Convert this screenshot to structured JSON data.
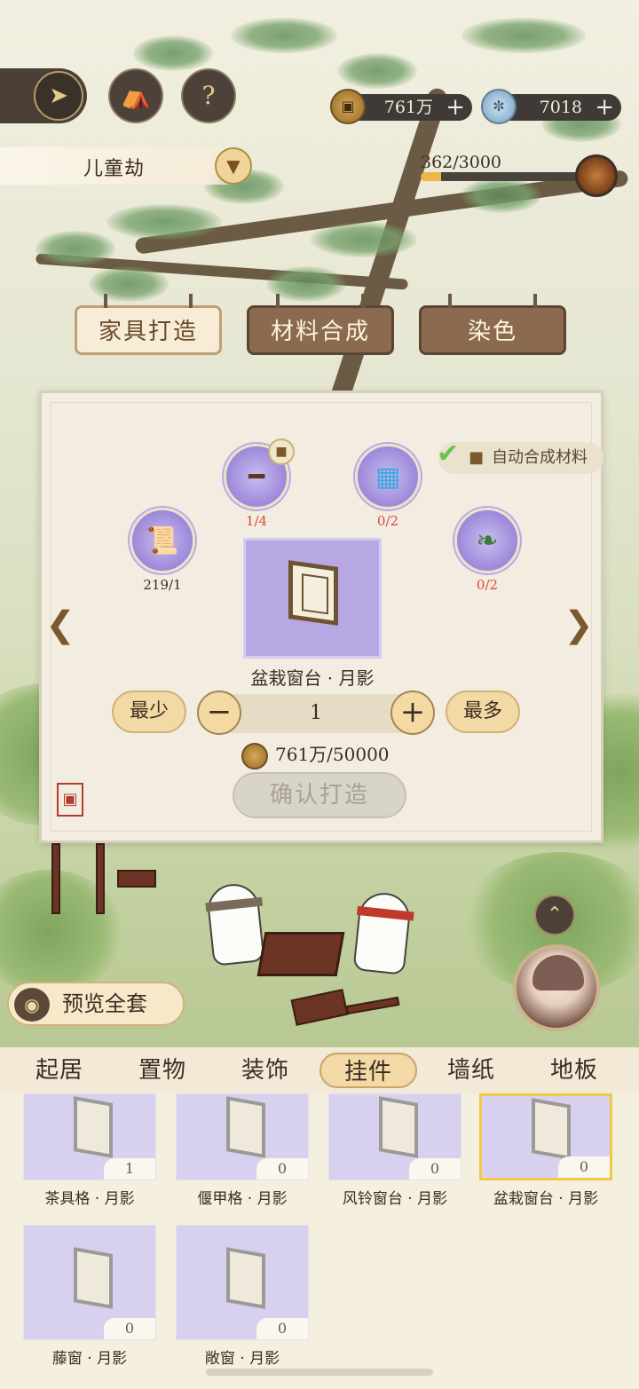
{
  "header": {
    "coins": "761万",
    "jade": "7018",
    "plus": "+",
    "help": "?",
    "exp": "362/3000",
    "exp_ratio": 0.1207
  },
  "banner": {
    "title": "儿童劫"
  },
  "signs": [
    {
      "label": "家具打造",
      "active": true
    },
    {
      "label": "材料合成",
      "active": false
    },
    {
      "label": "染色",
      "active": false
    }
  ],
  "craft": {
    "auto_synth": "自动合成材料",
    "materials": [
      {
        "icon": "scroll-icon",
        "count": "219/1"
      },
      {
        "icon": "wood-beam-icon",
        "count": "1/4"
      },
      {
        "icon": "blue-brick-icon",
        "count": "0/2"
      },
      {
        "icon": "vine-icon",
        "count": "0/2"
      }
    ],
    "item_name": "盆栽窗台 · 月影",
    "min_label": "最少",
    "max_label": "最多",
    "minus": "−",
    "plus": "+",
    "quantity": "1",
    "cost": "761万/50000",
    "confirm_label": "确认打造"
  },
  "preview_all": "预览全套",
  "categories": [
    "起居",
    "置物",
    "装饰",
    "挂件",
    "墙纸",
    "地板"
  ],
  "active_category": "挂件",
  "items": [
    {
      "name": "茶具格 · 月影",
      "count": "1"
    },
    {
      "name": "偃甲格 · 月影",
      "count": "0"
    },
    {
      "name": "风铃窗台 · 月影",
      "count": "0"
    },
    {
      "name": "盆栽窗台 · 月影",
      "count": "0",
      "selected": true
    },
    {
      "name": "藤窗 · 月影",
      "count": "0"
    },
    {
      "name": "敞窗 · 月影",
      "count": "0"
    }
  ]
}
